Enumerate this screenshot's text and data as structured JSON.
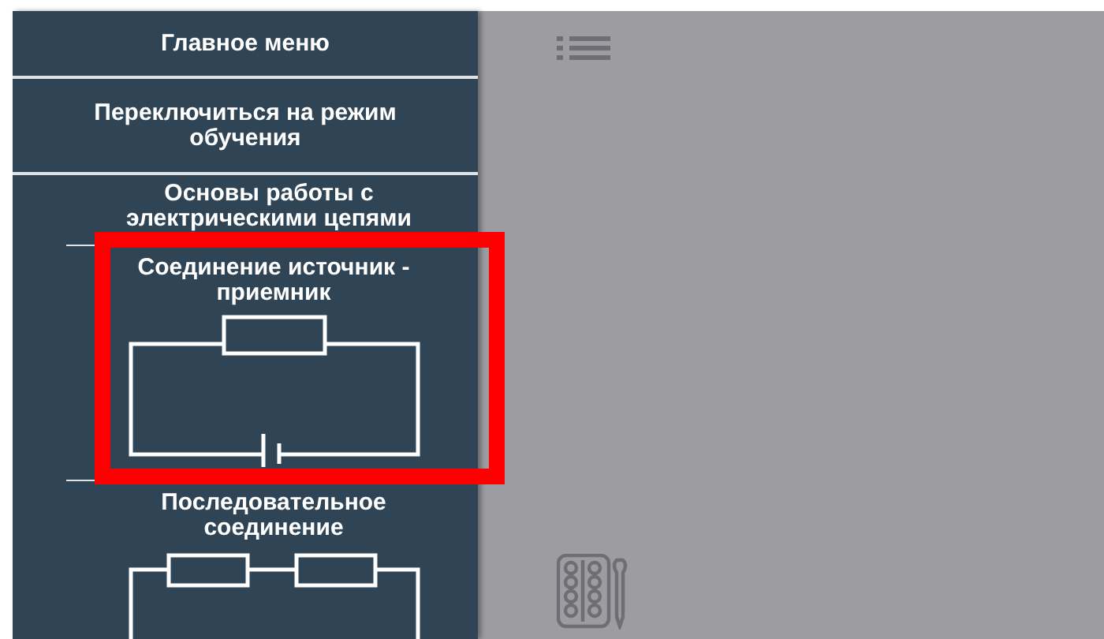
{
  "sidebar": {
    "items": [
      {
        "kind": "header",
        "label": "Главное меню"
      },
      {
        "kind": "button",
        "label": "Переключиться на режим обучения"
      },
      {
        "kind": "section",
        "label": "Основы работы с электрическими цепями"
      },
      {
        "kind": "source-load-circuit",
        "label": "Соединение источник - приемник",
        "highlighted": true
      },
      {
        "kind": "series-circuit",
        "label": "Последовательное соединение",
        "highlighted": false
      }
    ]
  }
}
